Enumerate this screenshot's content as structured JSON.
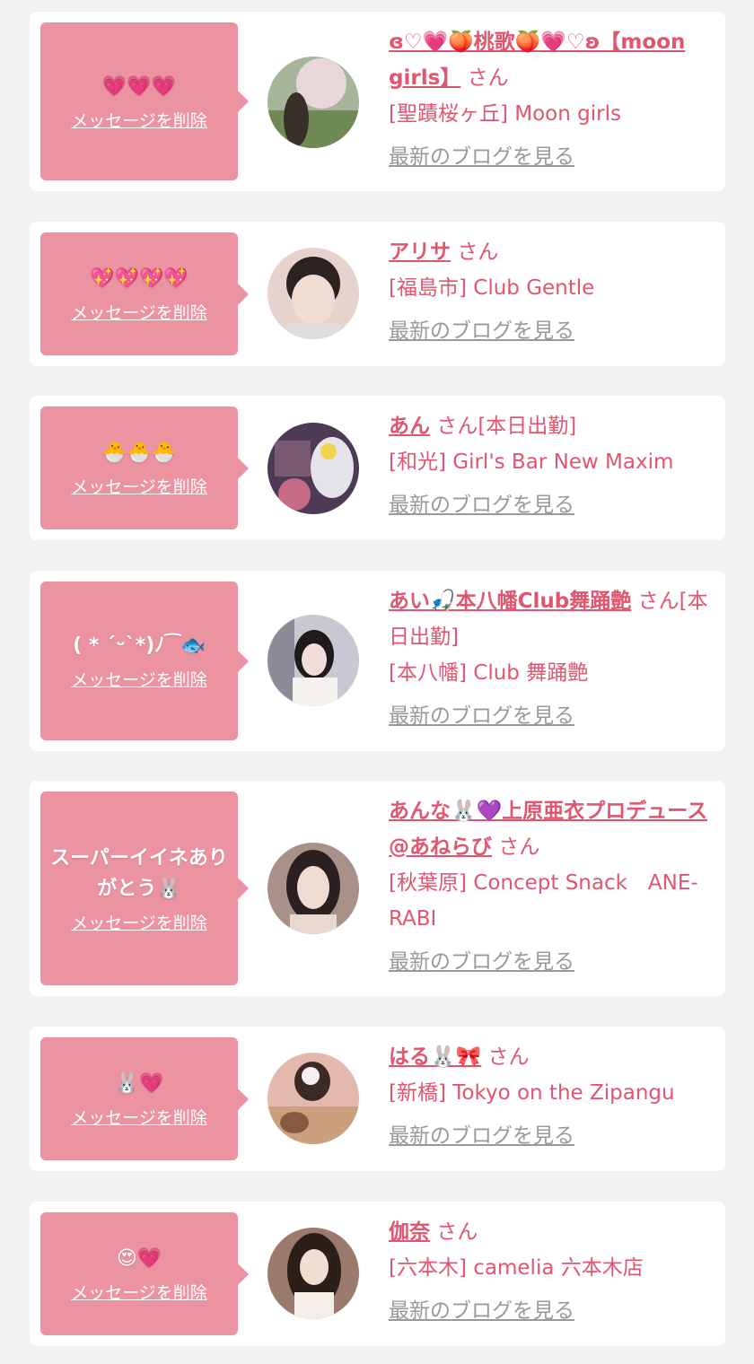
{
  "cards": [
    {
      "bubble_msg": "💗💗💗",
      "delete_label": "メッセージを削除",
      "name": "ɞ♡💗🍑桃歌🍑💗♡ʚ【moon girls】",
      "honorific": "さん",
      "shop": "[聖蹟桜ヶ丘] Moon girls",
      "blog_link": "最新のブログを見る",
      "avatar_color": "#7a9a6a"
    },
    {
      "bubble_msg": "💖💖💖💖",
      "delete_label": "メッセージを削除",
      "name": "アリサ",
      "honorific": "さん",
      "shop": "[福島市] Club Gentle",
      "blog_link": "最新のブログを見る",
      "avatar_color": "#caa89a"
    },
    {
      "bubble_msg": "🐣🐣🐣",
      "delete_label": "メッセージを削除",
      "name": "あん",
      "honorific": "さん[本日出勤]",
      "shop": "[和光] Girl's Bar New Maxim",
      "blog_link": "最新のブログを見る",
      "avatar_color": "#6b4a6e"
    },
    {
      "bubble_msg": "( * ˊᵕˋ*)ﾉ⁀🐟",
      "delete_label": "メッセージを削除",
      "name": "あい🎣本八幡Club舞踊艶",
      "honorific": "さん[本日出勤]",
      "shop": "[本八幡] Club 舞踊艶",
      "blog_link": "最新のブログを見る",
      "avatar_color": "#cfcfd6"
    },
    {
      "bubble_msg": "スーパーイイネありがとう🐰",
      "delete_label": "メッセージを削除",
      "name": "あんな🐰💜上原亜衣プロデュース@あねらび",
      "honorific": "さん",
      "shop": "[秋葉原] Concept Snack　ANE-RABI",
      "blog_link": "最新のブログを見る",
      "avatar_color": "#b79a8a"
    },
    {
      "bubble_msg": "🐰💗",
      "delete_label": "メッセージを削除",
      "name": "はる🐰🎀",
      "honorific": "さん",
      "shop": "[新橋] Tokyo on the Zipangu",
      "blog_link": "最新のブログを見る",
      "avatar_color": "#d8a99a"
    },
    {
      "bubble_msg": "😍💗",
      "delete_label": "メッセージを削除",
      "name": "伽奈",
      "honorific": "さん",
      "shop": "[六本木] camelia 六本木店",
      "blog_link": "最新のブログを見る",
      "avatar_color": "#8a6a5a"
    }
  ]
}
